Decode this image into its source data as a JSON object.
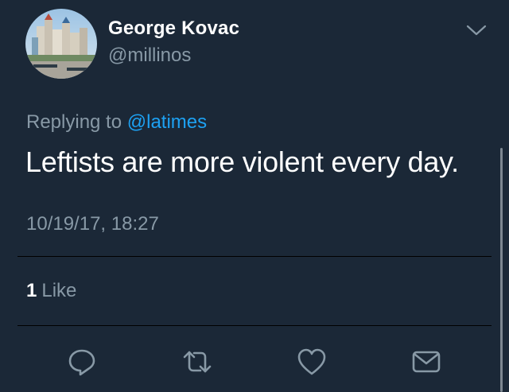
{
  "user": {
    "name": "George Kovac",
    "handle": "@millinos"
  },
  "reply": {
    "prefix": "Replying to ",
    "mention": "@latimes"
  },
  "tweet": {
    "text": "Leftists are more violent every day.",
    "timestamp": "10/19/17, 18:27"
  },
  "stats": {
    "like_count": "1",
    "like_label": "Like"
  },
  "actions": [
    "reply-icon",
    "retweet-icon",
    "like-heart-icon",
    "direct-message-icon"
  ],
  "colors": {
    "background": "#1b2837",
    "secondary_text": "#8899a6",
    "link": "#1da1f2",
    "divider": "#000000"
  }
}
